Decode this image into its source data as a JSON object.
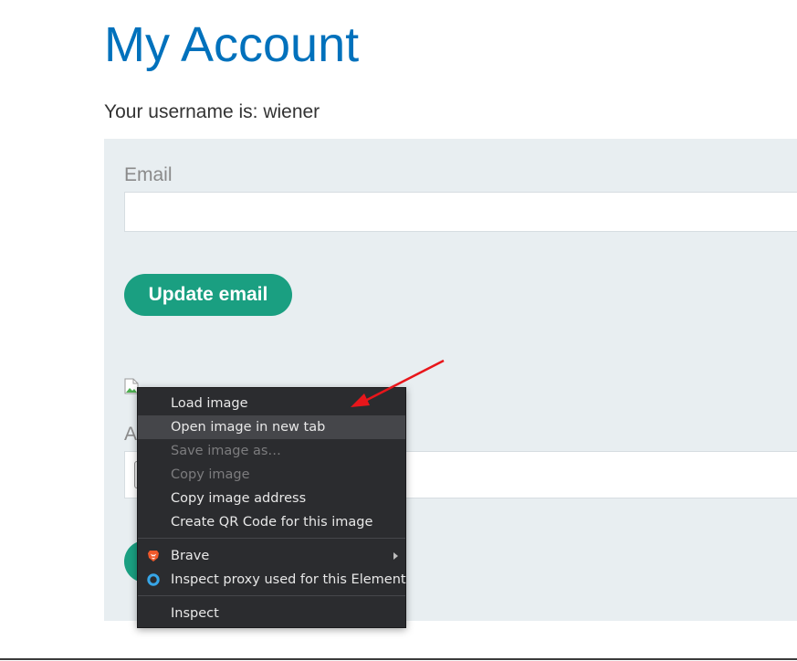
{
  "page": {
    "title": "My Account",
    "username_text": "Your username is: wiener"
  },
  "form": {
    "email_label": "Email",
    "email_value": "",
    "update_button_label": "Update email",
    "second_label_partial": "A"
  },
  "context_menu": {
    "items": [
      {
        "label": "Load image",
        "enabled": true
      },
      {
        "label": "Open image in new tab",
        "enabled": true,
        "highlighted": true
      },
      {
        "label": "Save image as…",
        "enabled": false
      },
      {
        "label": "Copy image",
        "enabled": false
      },
      {
        "label": "Copy image address",
        "enabled": true
      },
      {
        "label": "Create QR Code for this image",
        "enabled": true
      }
    ],
    "extensions": [
      {
        "label": "Brave",
        "icon": "brave-lion-icon",
        "has_submenu": true
      },
      {
        "label": "Inspect proxy used for this Element",
        "icon": "proxy-ring-icon"
      }
    ],
    "inspect_label": "Inspect"
  },
  "colors": {
    "title": "#0071bc",
    "button": "#1a9f81",
    "panel": "#e8eef1",
    "menu_bg": "#2b2c2f",
    "menu_highlight": "#45464a",
    "annotation_arrow": "#e8161b",
    "brave_icon": "#f0592b",
    "proxy_icon": "#37a6e8"
  }
}
